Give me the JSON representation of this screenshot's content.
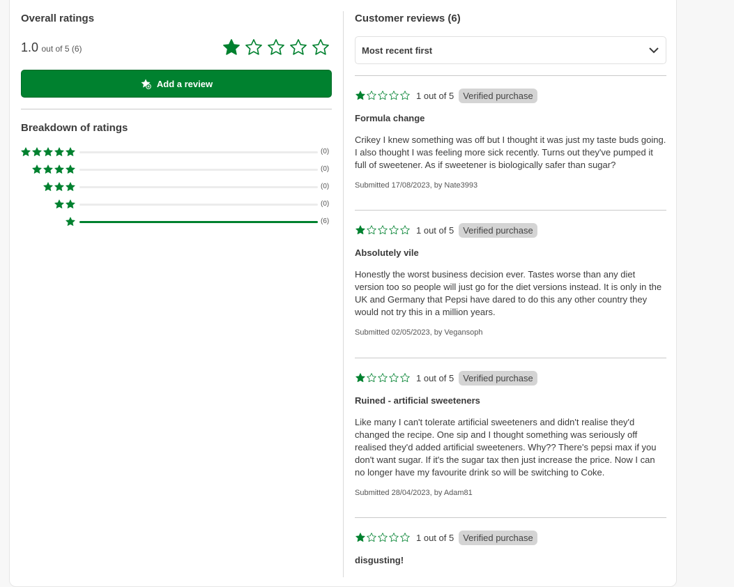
{
  "overall": {
    "title": "Overall ratings",
    "score": "1.0",
    "score_suffix": "out of 5 (6)",
    "stars_filled": 1,
    "stars_total": 5,
    "add_review_label": "Add a review",
    "breakdown_title": "Breakdown of ratings",
    "breakdown": [
      {
        "stars": 5,
        "count_label": "(0)",
        "fraction": 0
      },
      {
        "stars": 4,
        "count_label": "(0)",
        "fraction": 0
      },
      {
        "stars": 3,
        "count_label": "(0)",
        "fraction": 0
      },
      {
        "stars": 2,
        "count_label": "(0)",
        "fraction": 0
      },
      {
        "stars": 1,
        "count_label": "(6)",
        "fraction": 1
      }
    ]
  },
  "reviews": {
    "title": "Customer reviews (6)",
    "sort_label": "Most recent first",
    "items": [
      {
        "rating": 1,
        "out_of": "1 out of 5",
        "badge": "Verified purchase",
        "title": "Formula change",
        "body": "Crikey I knew something was off but I thought it was just my taste buds going. I also thought I was feeling more sick recently. Turns out they've pumped it full of sweetener. As if sweetener is biologically safer than sugar?",
        "meta": "Submitted 17/08/2023, by Nate3993"
      },
      {
        "rating": 1,
        "out_of": "1 out of 5",
        "badge": "Verified purchase",
        "title": "Absolutely vile",
        "body": "Honestly the worst business decision ever. Tastes worse than any diet version too so people will just go for the diet versions instead. It is only in the UK and Germany that Pepsi have dared to do this any other country they would not try this in a million years.",
        "meta": "Submitted 02/05/2023, by Vegansoph"
      },
      {
        "rating": 1,
        "out_of": "1 out of 5",
        "badge": "Verified purchase",
        "title": "Ruined - artificial sweeteners",
        "body": "Like many I can't tolerate artificial sweeteners and didn't realise they'd changed the recipe. One sip and I thought something was seriously off realised they'd added artificial sweeteners. Why?? There's pepsi max if you don't want sugar. If it's the sugar tax then just increase the price. Now I can no longer have my favourite drink so will be switching to Coke.",
        "meta": "Submitted 28/04/2023, by Adam81"
      },
      {
        "rating": 1,
        "out_of": "1 out of 5",
        "badge": "Verified purchase",
        "title": "disgusting!",
        "body": "",
        "meta": ""
      }
    ]
  },
  "colors": {
    "brand_green": "#00812f",
    "badge_bg": "#d4d4d4",
    "text": "#3b3b3b"
  },
  "icons": {
    "star_filled": "star-filled-icon",
    "star_outline": "star-outline-icon",
    "add_review": "star-plus-icon",
    "sort": "chevron-down-icon"
  }
}
